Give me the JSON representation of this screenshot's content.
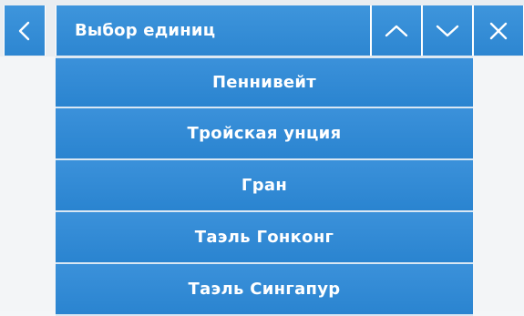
{
  "header": {
    "title": "Выбор единиц",
    "icons": {
      "back": "chevron-left-icon",
      "up": "chevron-up-icon",
      "down": "chevron-down-icon",
      "close": "close-icon"
    }
  },
  "units": {
    "items": [
      {
        "label": "Пеннивейт"
      },
      {
        "label": "Тройская унция"
      },
      {
        "label": "Гран"
      },
      {
        "label": "Таэль Гонконг"
      },
      {
        "label": "Таэль Сингапур"
      }
    ]
  },
  "colors": {
    "accent": "#2f88d3",
    "text": "#ffffff",
    "background": "#f3f5f7"
  }
}
